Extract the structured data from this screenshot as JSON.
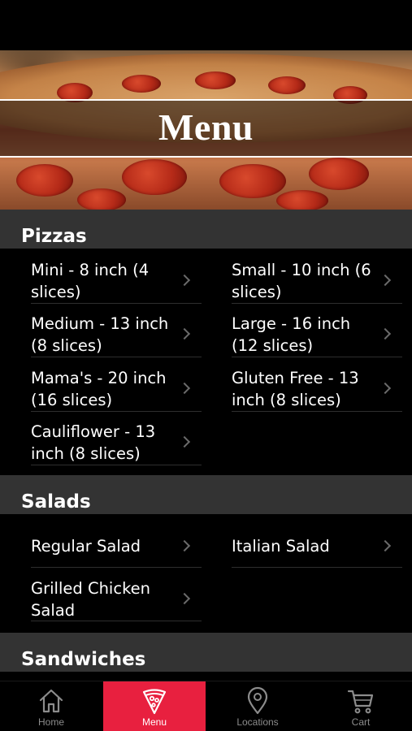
{
  "hero": {
    "title": "Menu"
  },
  "sections": {
    "pizzas": {
      "title": "Pizzas",
      "items": [
        {
          "label": "Mini - 8 inch (4 slices)"
        },
        {
          "label": "Small - 10 inch (6 slices)"
        },
        {
          "label": "Medium - 13 inch (8 slices)"
        },
        {
          "label": "Large - 16 inch (12 slices)"
        },
        {
          "label": "Mama's - 20 inch (16 slices)"
        },
        {
          "label": "Gluten Free - 13 inch (8 slices)"
        },
        {
          "label": "Cauliflower - 13 inch (8 slices)"
        }
      ]
    },
    "salads": {
      "title": "Salads",
      "items": [
        {
          "label": "Regular Salad"
        },
        {
          "label": "Italian Salad"
        },
        {
          "label": "Grilled Chicken Salad"
        }
      ]
    },
    "sandwiches": {
      "title": "Sandwiches"
    }
  },
  "tabs": [
    {
      "label": "Home",
      "icon": "home-icon"
    },
    {
      "label": "Menu",
      "icon": "pizza-slice-icon",
      "active": true
    },
    {
      "label": "Locations",
      "icon": "location-pin-icon"
    },
    {
      "label": "Cart",
      "icon": "cart-icon"
    }
  ],
  "colors": {
    "accent": "#e8203f",
    "section_header": "#333333",
    "background": "#000000"
  }
}
